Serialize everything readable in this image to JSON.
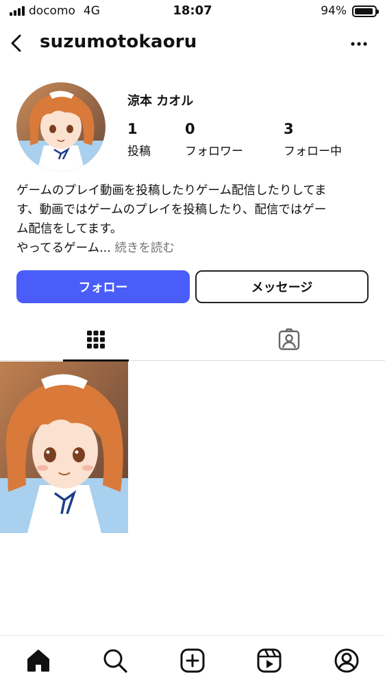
{
  "status_bar": {
    "carrier": "docomo",
    "network": "4G",
    "time": "18:07",
    "battery_percent_label": "94%",
    "battery_level": 0.94
  },
  "header": {
    "username": "suzumotokaoru",
    "back_icon": "chevron-left-icon",
    "more_icon": "more-horizontal-icon"
  },
  "profile": {
    "display_name": "涼本 カオル",
    "stats": [
      {
        "value": "1",
        "label": "投稿"
      },
      {
        "value": "0",
        "label": "フォロワー"
      },
      {
        "value": "3",
        "label": "フォロー中"
      }
    ],
    "bio_lines": [
      "ゲームのプレイ動画を投稿したりゲーム配信したりしてま",
      "す、動画ではゲームのプレイを投稿したり、配信ではゲー",
      "ム配信をしてます。",
      "やってるゲーム..."
    ],
    "read_more_label": "続きを読む"
  },
  "actions": {
    "follow_label": "フォロー",
    "message_label": "メッセージ",
    "follow_color": "#4a5df9"
  },
  "tabs": {
    "grid_icon": "grid-icon",
    "tagged_icon": "tagged-person-icon",
    "active": "grid"
  },
  "posts": [
    {
      "type": "image",
      "description_icon": "anime-maid-girl-image"
    }
  ],
  "bottom_nav": [
    {
      "icon": "home-icon",
      "active": true
    },
    {
      "icon": "search-icon",
      "active": false
    },
    {
      "icon": "create-post-icon",
      "active": false
    },
    {
      "icon": "reels-icon",
      "active": false
    },
    {
      "icon": "profile-icon",
      "active": false
    }
  ]
}
